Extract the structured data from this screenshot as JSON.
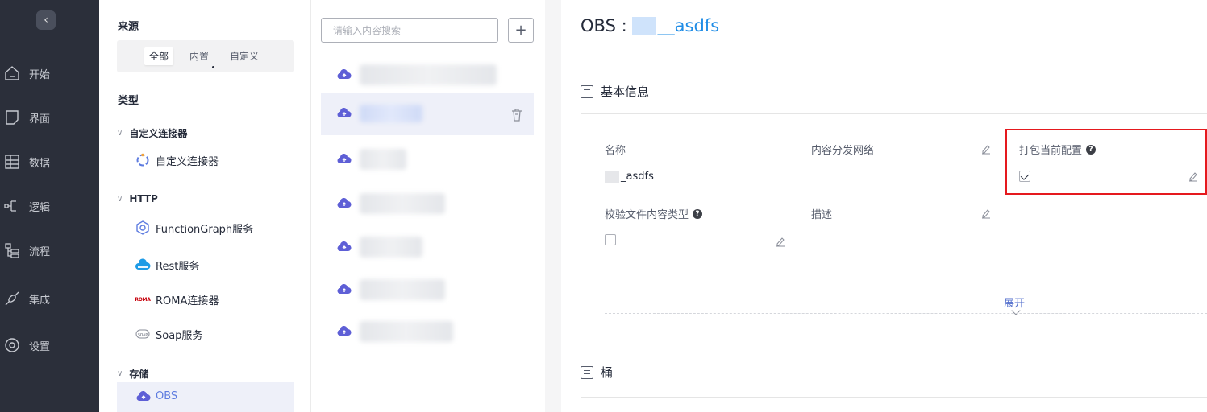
{
  "leftnav": {
    "items": [
      {
        "label": "开始",
        "icon": "home-icon"
      },
      {
        "label": "界面",
        "icon": "page-icon"
      },
      {
        "label": "数据",
        "icon": "table-icon"
      },
      {
        "label": "逻辑",
        "icon": "logic-icon"
      },
      {
        "label": "流程",
        "icon": "flow-icon"
      },
      {
        "label": "集成",
        "icon": "integration-icon"
      },
      {
        "label": "设置",
        "icon": "settings-icon"
      }
    ]
  },
  "sources": {
    "title": "来源",
    "options": [
      "全部",
      "内置",
      "自定义"
    ],
    "selected": "全部"
  },
  "types": {
    "title": "类型",
    "groups": [
      {
        "label": "自定义连接器",
        "items": [
          "自定义连接器"
        ]
      },
      {
        "label": "HTTP",
        "items": [
          "FunctionGraph服务",
          "Rest服务",
          "ROMA连接器",
          "Soap服务"
        ]
      },
      {
        "label": "存储",
        "items": [
          "OBS"
        ]
      }
    ]
  },
  "list": {
    "search_placeholder": "请输入内容搜索",
    "add_label": "+"
  },
  "detail": {
    "title_prefix": "OBS : ",
    "title_name": "__asdfs",
    "basic_info_title": "基本信息",
    "bucket_title": "桶",
    "fields": {
      "name_label": "名称",
      "name_value": "_asdfs",
      "cdn_label": "内容分发网络",
      "pack_label": "打包当前配置",
      "pack_checked": true,
      "verify_label": "校验文件内容类型",
      "verify_checked": false,
      "desc_label": "描述"
    },
    "expand_label": "展开",
    "help_glyph": "?"
  },
  "colors": {
    "accent": "#5e7ce0",
    "highlight_box": "#e5191e",
    "nav_bg": "#2b2f3a"
  }
}
